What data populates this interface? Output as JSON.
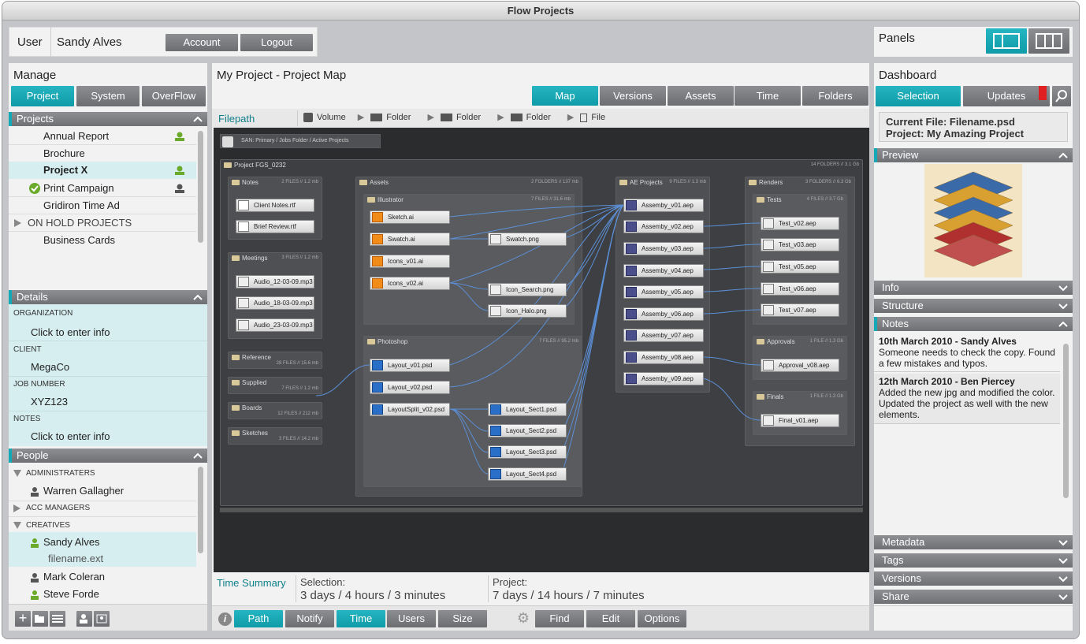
{
  "window": {
    "title": "Flow Projects"
  },
  "user": {
    "label": "User",
    "name": "Sandy Alves",
    "account": "Account",
    "logout": "Logout"
  },
  "panels": {
    "label": "Panels"
  },
  "manage": {
    "title": "Manage",
    "tabs": [
      "Project",
      "System",
      "OverFlow"
    ],
    "projects_header": "Projects",
    "projects": [
      "Annual Report",
      "Brochure",
      "Project X",
      "Print Campaign",
      "Gridiron Time Ad",
      "ON HOLD PROJECTS",
      "Business Cards"
    ],
    "details_header": "Details",
    "details": [
      {
        "label": "ORGANIZATION",
        "value": "Click to enter info"
      },
      {
        "label": "CLIENT",
        "value": "MegaCo"
      },
      {
        "label": "JOB NUMBER",
        "value": "XYZ123"
      },
      {
        "label": "NOTES",
        "value": "Click to enter info"
      }
    ],
    "people_header": "People",
    "people": {
      "g1": "ADMINISTRATERS",
      "p1": "Warren Gallagher",
      "g2": "ACC MANAGERS",
      "g3": "CREATIVES",
      "p2": "Sandy Alves",
      "p2file": "filename.ext",
      "p3": "Mark Coleran",
      "p4": "Steve Forde"
    }
  },
  "center": {
    "title": "My Project - Project Map",
    "tabs": [
      "Map",
      "Versions",
      "Assets",
      "Time",
      "Folders"
    ],
    "filepath": "Filepath",
    "crumbs": [
      "Volume",
      "Folder",
      "Folder",
      "Folder",
      "File"
    ],
    "map": {
      "san": "SAN: Primary / Jobs Folder / Active Projects",
      "project": "Project FGS_0232",
      "project_info": "14 FOLDERS // 3.1 Gb",
      "notes": "Notes",
      "notes_info": "2 FILES // 1.2 mb",
      "note_files": [
        "Client Notes.rtf",
        "Brief Review.rtf"
      ],
      "meetings": "Meetings",
      "meetings_info": "3 FILES // 1.2 mb",
      "meeting_files": [
        "Audio_12-03-09.mp3",
        "Audio_18-03-09.mp3",
        "Audio_23-03-09.mp3"
      ],
      "reference": "Reference",
      "reference_info": "28 FILES // 15.6 mb",
      "supplied": "Supplied",
      "supplied_info": "7 FILES // 1.2 mb",
      "boards": "Boards",
      "boards_info": "12 FILES // 212 mb",
      "sketches": "Sketches",
      "sketches_info": "3 FILES // 14.2 mb",
      "assets": "Assets",
      "assets_info": "2 FOLDERS // 137 mb",
      "illustrator": "Illustrator",
      "illustrator_info": "7 FILES // 31.6 mb",
      "ai_files": [
        "Sketch.ai",
        "Swatch.ai",
        "Icons_v01.ai",
        "Icons_v02.ai"
      ],
      "png_files": [
        "Swatch.png",
        "Icon_Search.png",
        "Icon_Halo.png"
      ],
      "photoshop": "Photoshop",
      "photoshop_info": "7 FILES // 95.2 mb",
      "psd_files": [
        "Layout_v01.psd",
        "Layout_v02.psd",
        "LayoutSplit_v02.psd"
      ],
      "sect_files": [
        "Layout_Sect1.psd",
        "Layout_Sect2.psd",
        "Layout_Sect3.psd",
        "Layout_Sect4.psd"
      ],
      "ae": "AE Projects",
      "ae_info": "9 FILES // 1.3 mb",
      "ae_files": [
        "Assemby_v01.aep",
        "Assemby_v02.aep",
        "Assemby_v03.aep",
        "Assemby_v04.aep",
        "Assemby_v05.aep",
        "Assemby_v06.aep",
        "Assemby_v07.aep",
        "Assemby_v08.aep",
        "Assemby_v09.aep"
      ],
      "renders": "Renders",
      "renders_info": "3 FOLDERS // 6.3 Gb",
      "tests": "Tests",
      "tests_info": "4 FILES // 3.7 Gb",
      "test_files": [
        "Test_v02.aep",
        "Test_v03.aep",
        "Test_v05.aep",
        "Test_v06.aep",
        "Test_v07.aep"
      ],
      "approvals": "Approvals",
      "approvals_info": "1 FILE // 1.3 Gb",
      "approval_file": "Approval_v08.aep",
      "finals": "Finals",
      "finals_info": "1 FILE // 1.3 Gb",
      "final_file": "Final_v01.aep"
    },
    "time_summary": "Time Summary",
    "selection_label": "Selection:",
    "selection_value": "3 days / 4 hours / 3 minutes",
    "project_label": "Project:",
    "project_value": "7 days / 14 hours / 7 minutes",
    "bottom_left": [
      "Path",
      "Notify",
      "Time",
      "Users",
      "Size"
    ],
    "bottom_right": [
      "Find",
      "Edit",
      "Options"
    ]
  },
  "dashboard": {
    "title": "Dashboard",
    "tabs": [
      "Selection",
      "Updates"
    ],
    "current_file": "Current File: Filename.psd",
    "project": "Project: My Amazing Project",
    "sections": {
      "preview": "Preview",
      "info": "Info",
      "structure": "Structure",
      "notes": "Notes",
      "metadata": "Metadata",
      "tags": "Tags",
      "versions": "Versions",
      "share": "Share"
    },
    "notes": [
      {
        "head": "10th March 2010 - Sandy Alves",
        "body": "Someone needs to check the copy. Found a few mistakes and typos."
      },
      {
        "head": "12th March 2010 - Ben Piercey",
        "body": "Added the new jpg and modified the color. Updated the project as well with the new elements."
      }
    ]
  },
  "colors": {
    "accent": "#14a9b6",
    "button": "#7b7d81",
    "map_bg": "#444548"
  }
}
